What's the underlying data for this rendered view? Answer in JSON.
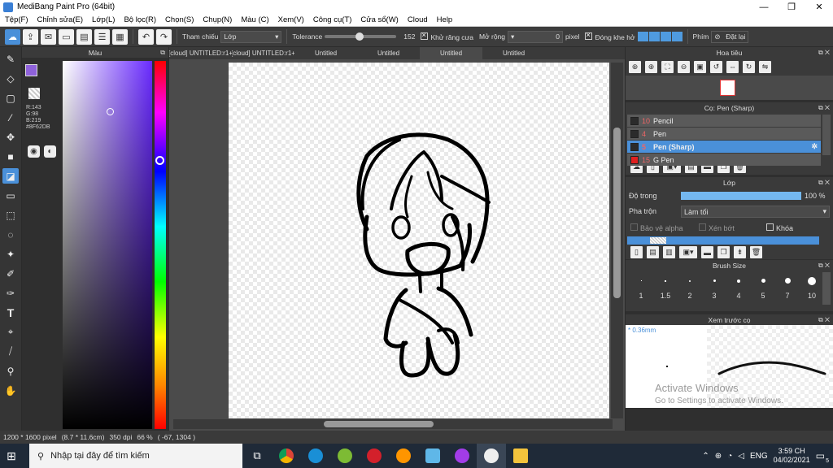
{
  "window": {
    "title": "MediBang Paint Pro (64bit)",
    "minimize": "—",
    "maximize": "❐",
    "close": "✕"
  },
  "menu": [
    "Tệp(F)",
    "Chỉnh sửa(E)",
    "Lớp(L)",
    "Bộ lọc(R)",
    "Chọn(S)",
    "Chụp(N)",
    "Màu (C)",
    "Xem(V)",
    "Công cụ(T)",
    "Cửa sổ(W)",
    "Cloud",
    "Help"
  ],
  "toolbar": {
    "reference_label": "Tham chiếu",
    "reference_value": "Lớp",
    "tolerance_label": "Tolerance",
    "tolerance_value": "152",
    "antialias_label": "Khử răng cưa",
    "expand_label": "Mở rộng",
    "expand_value": "0",
    "expand_unit": "pixel",
    "close_gap_label": "Đóng khe hở",
    "key_label": "Phím",
    "unset_label": "Đặt lại"
  },
  "colors": {
    "primary": "#8F62DB",
    "secondary": "#3a2fd0",
    "accent": "#4a90d9",
    "r_label": "R:143",
    "g_label": "G:98",
    "b_label": "B:219",
    "hex_label": "#8F62DB"
  },
  "color_panel": {
    "title": "Màu"
  },
  "tabs": [
    "[cloud] UNTITLED:r1+",
    "[cloud] UNTITLED:r1+",
    "Untitled",
    "Untitled",
    "Untitled",
    "Untitled"
  ],
  "navigator": {
    "title": "Hoa tiêu"
  },
  "brush": {
    "title": "Cọ: Pen (Sharp)",
    "items": [
      {
        "num": "10",
        "name": "Pencil",
        "color": "#2b2b2b"
      },
      {
        "num": "4",
        "name": "Pen",
        "color": "#2b2b2b"
      },
      {
        "num": "5",
        "name": "Pen (Sharp)",
        "color": "#2b2b2b"
      },
      {
        "num": "15",
        "name": "G Pen",
        "color": "#e02020"
      }
    ]
  },
  "layer": {
    "title": "Lớp",
    "opacity_label": "Độ trong",
    "opacity_value": "100 %",
    "opacity_level": 1.0,
    "blend_label": "Pha trộn",
    "blend_value": "Làm tối",
    "protect_alpha": "Bảo vệ alpha",
    "clip": "Xén bớt",
    "lock": "Khóa"
  },
  "brush_size": {
    "title": "Brush Size",
    "sizes": [
      "1",
      "1.5",
      "2",
      "3",
      "4",
      "5",
      "7",
      "10"
    ]
  },
  "preview": {
    "title": "Xem trước cọ",
    "size": "* 0.36mm",
    "watermark1": "Activate Windows",
    "watermark2": "Go to Settings to activate Windows."
  },
  "status": {
    "dimensions": "1200 * 1600 pixel",
    "physical": "(8.7 * 11.6cm)",
    "dpi": "350 dpi",
    "zoom": "66 %",
    "coords": "( -67, 1304 )"
  },
  "taskbar": {
    "search_placeholder": "Nhập tại đây để tìm kiếm",
    "time": "3:59 CH",
    "date": "04/02/2021",
    "lang": "ENG",
    "notif_count": "5"
  }
}
